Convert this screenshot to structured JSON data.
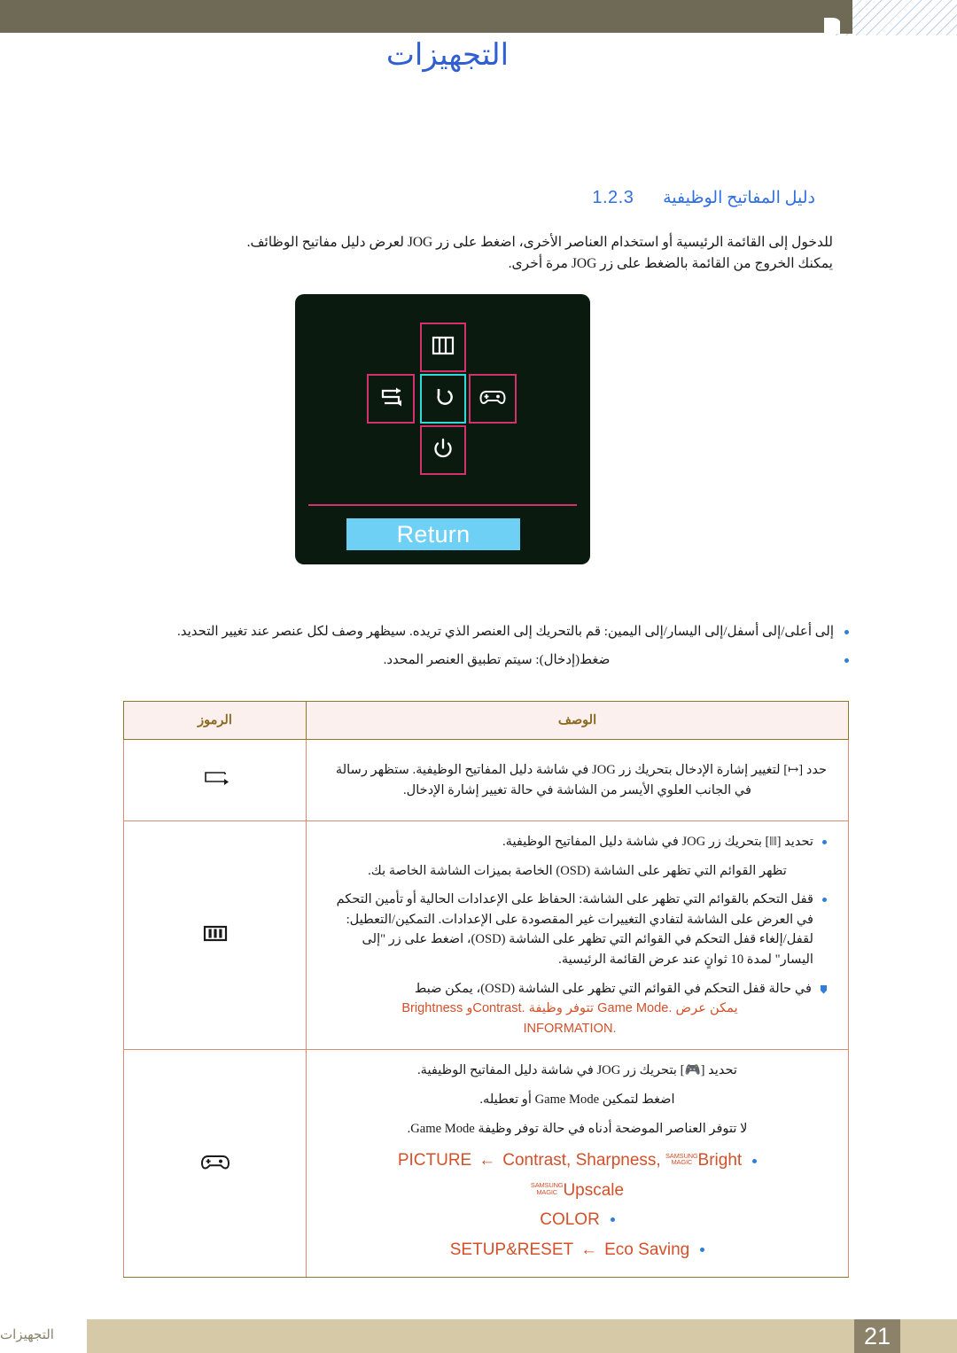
{
  "header": {
    "title": "التجهيزات",
    "band_color": "#6e6a56",
    "title_color": "#2f5fd0"
  },
  "section": {
    "number": "1.2.3",
    "label": "دليل المفاتيح الوظيفية"
  },
  "intro": {
    "line1": "للدخول إلى القائمة الرئيسية أو استخدام العناصر الأخرى، اضغط على زر JOG لعرض دليل مفاتيح الوظائف.",
    "line2": "يمكنك الخروج من القائمة بالضغط على زر JOG مرة أخرى."
  },
  "osd": {
    "return_label": "Return",
    "keys": [
      {
        "position": "up",
        "icon": "menu-bars-icon",
        "selected": false
      },
      {
        "position": "left",
        "icon": "source-loop-icon",
        "selected": false
      },
      {
        "position": "center",
        "icon": "return-arrow-icon",
        "selected": true
      },
      {
        "position": "right",
        "icon": "gamepad-icon",
        "selected": false
      },
      {
        "position": "down",
        "icon": "power-icon",
        "selected": false
      }
    ],
    "background": "#0b1a0f",
    "border_color": "#d6316f",
    "selected_border_color": "#2fd9d9",
    "return_bg": "#6fd0f5"
  },
  "notes": [
    "إلى أعلى/إلى أسفل/إلى اليسار/إلى اليمين: قم بالتحريك إلى العنصر الذي تريده. سيظهر وصف لكل عنصر عند تغيير التحديد.",
    "ضغط(إدخال): سيتم تطبيق العنصر المحدد."
  ],
  "table": {
    "headers": {
      "description": "الوصف",
      "symbols": "الرموز"
    },
    "rows": [
      {
        "symbol": "source-loop-icon",
        "lines": [
          "حدد [↦] لتغيير إشارة الإدخال بتحريك زر JOG في شاشة دليل المفاتيح الوظيفية. ستظهر رسالة",
          "في الجانب العلوي الأيسر من الشاشة في حالة تغيير إشارة الإدخال."
        ]
      },
      {
        "symbol": "menu-bars-icon",
        "bullets": [
          {
            "type": "dot",
            "text": "تحديد [‖‖] بتحريك زر JOG في شاشة دليل المفاتيح الوظيفية."
          },
          {
            "type": "plain",
            "text": "تظهر القوائم التي تظهر على الشاشة (OSD) الخاصة بميزات الشاشة الخاصة بك."
          },
          {
            "type": "dot",
            "text": "قفل التحكم بالقوائم التي تظهر على الشاشة: الحفاظ على الإعدادات الحالية أو تأمين التحكم في العرض على الشاشة لتفادي التغييرات غير المقصودة على الإعدادات. التمكين/التعطيل: لقفل/إلغاء قفل التحكم في القوائم التي تظهر على الشاشة (OSD)، اضغط على زر \"إلى اليسار\" لمدة 10 ثوانٍ عند عرض القائمة الرئيسية."
          },
          {
            "type": "square",
            "text": "في حالة قفل التحكم في القوائم التي تظهر على الشاشة (OSD)، يمكن ضبط",
            "highlight_line": "Brightness وContrast. تتوفر وظيفة Game Mode. يمكن عرض",
            "highlight_tail": "INFORMATION."
          }
        ]
      },
      {
        "symbol": "gamepad-icon",
        "lines": [
          "تحديد [🎮] بتحريك زر JOG في شاشة دليل المفاتيح الوظيفية.",
          "اضغط لتمكين Game Mode أو تعطيله.",
          "لا تتوفر العناصر الموضحة أدناه في حالة توفر وظيفة Game Mode."
        ],
        "menu_items": [
          {
            "main": "PICTURE",
            "arrow": "←",
            "targets": "Contrast, Sharpness, ",
            "magic": true,
            "magic_label_top": "SAMSUNG",
            "magic_label_bottom": "MAGIC",
            "magic_value": "Bright"
          },
          {
            "sub_magic": true,
            "magic_label_top": "SAMSUNG",
            "magic_label_bottom": "MAGIC",
            "magic_value": "Upscale"
          },
          {
            "main": "COLOR"
          },
          {
            "main": "SETUP&RESET",
            "arrow": "←",
            "targets": "Eco Saving"
          }
        ]
      }
    ]
  },
  "footer": {
    "page_number": "21",
    "label": "التجهيزات",
    "bar_color": "#d6c9a8",
    "page_box_color": "#8c8269"
  }
}
